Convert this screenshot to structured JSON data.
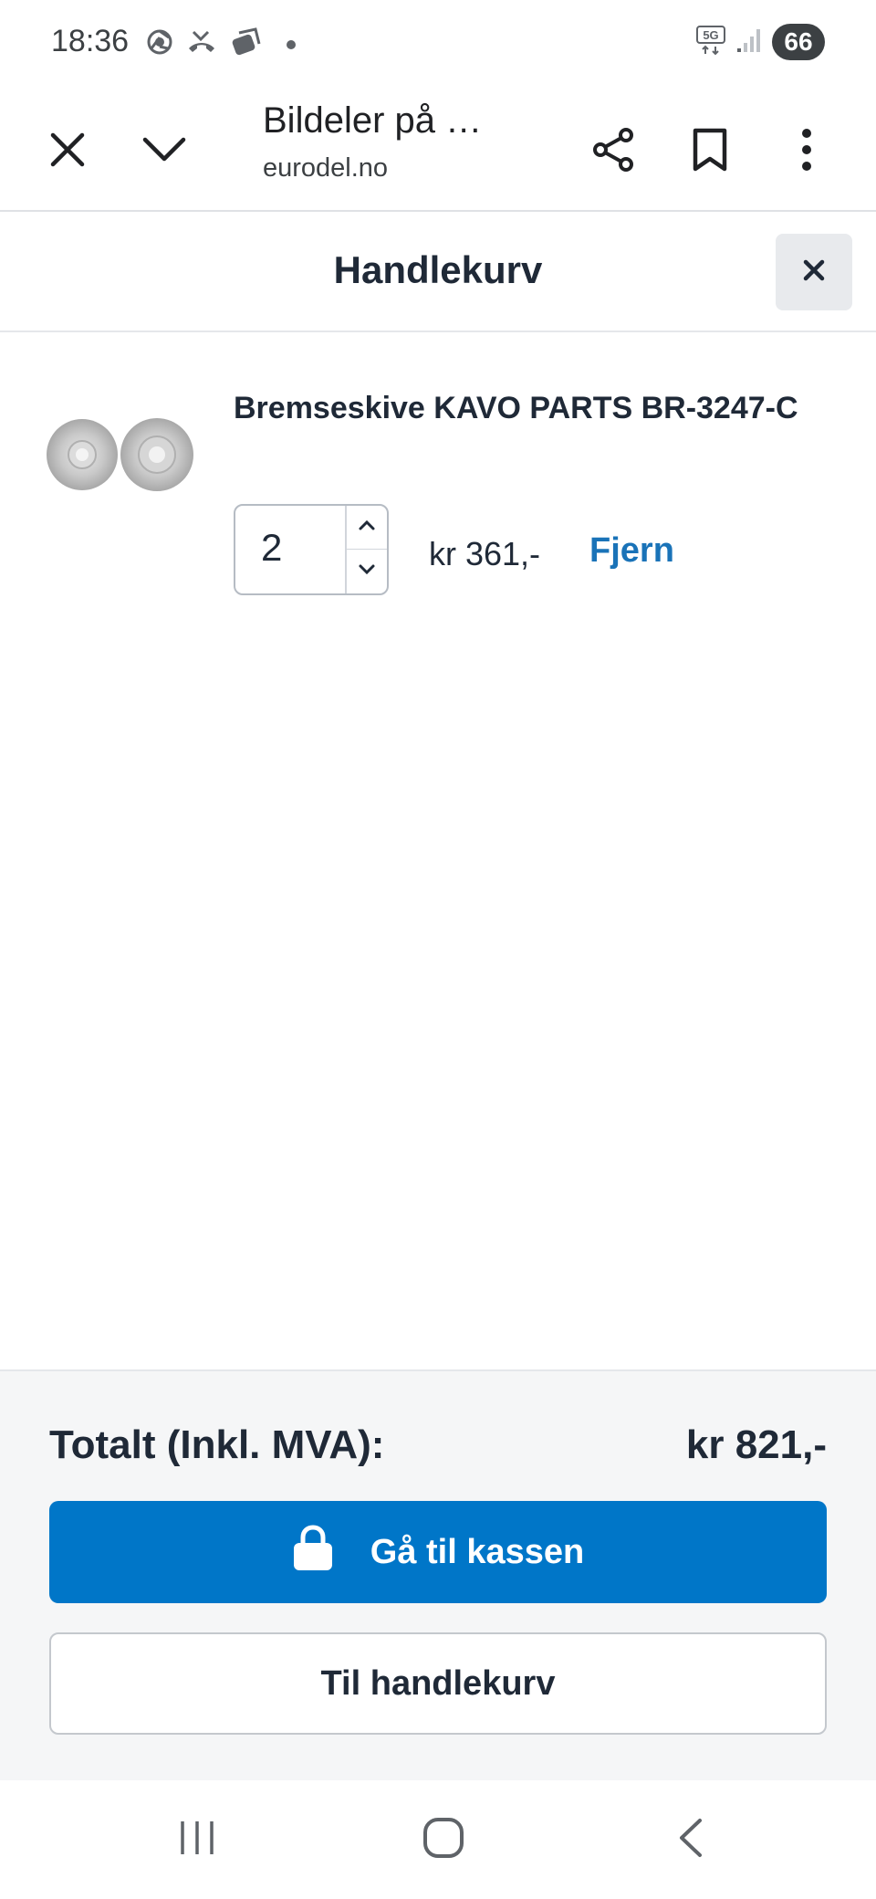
{
  "status_bar": {
    "time": "18:36",
    "battery": "66",
    "left_icons": [
      "chrome-icon",
      "missed-call-icon",
      "stack-icon",
      "notification-dot"
    ],
    "right_icons": [
      "5g-icon",
      "signal-icon",
      "battery-icon"
    ]
  },
  "browser": {
    "page_title": "Bildeler på …",
    "url": "eurodel.no",
    "icons": [
      "close-icon",
      "chevron-down-icon",
      "share-icon",
      "bookmark-icon",
      "more-vertical-icon"
    ]
  },
  "cart": {
    "title": "Handlekurv",
    "close_label": "×"
  },
  "items": [
    {
      "name": "Bremseskive KAVO PARTS BR-3247-C",
      "quantity": "2",
      "price": "kr 361,-",
      "remove_label": "Fjern",
      "image": "brake-disc-image"
    }
  ],
  "summary": {
    "total_label": "Totalt (Inkl. MVA):",
    "total_value": "kr 821,-"
  },
  "actions": {
    "checkout_label": "Gå til kassen",
    "view_cart_label": "Til handlekurv"
  },
  "navigation": {
    "icons": [
      "recent-apps-icon",
      "home-icon",
      "back-icon"
    ]
  },
  "colors": {
    "primary": "#0076c8",
    "link": "#1a73b8",
    "text": "#1f2937",
    "footer_bg": "#f5f6f7"
  }
}
